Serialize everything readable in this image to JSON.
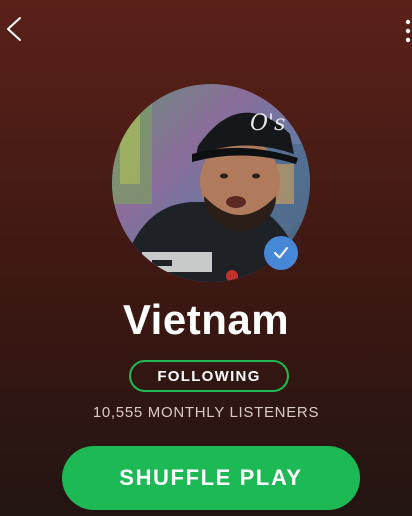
{
  "header": {
    "back_icon": "chevron-left-icon",
    "more_icon": "more-vertical-icon"
  },
  "artist": {
    "name": "Vietnam",
    "avatar_icon": "artist-avatar",
    "verified_icon": "verified-checkmark-icon",
    "follow_label": "FOLLOWING",
    "monthly_listeners": "10,555 MONTHLY LISTENERS"
  },
  "actions": {
    "shuffle_label": "SHUFFLE PLAY"
  },
  "colors": {
    "accent_green": "#1db954",
    "verified_blue": "#4687d6",
    "background_top": "#5a2119",
    "background_bottom": "#221512"
  }
}
